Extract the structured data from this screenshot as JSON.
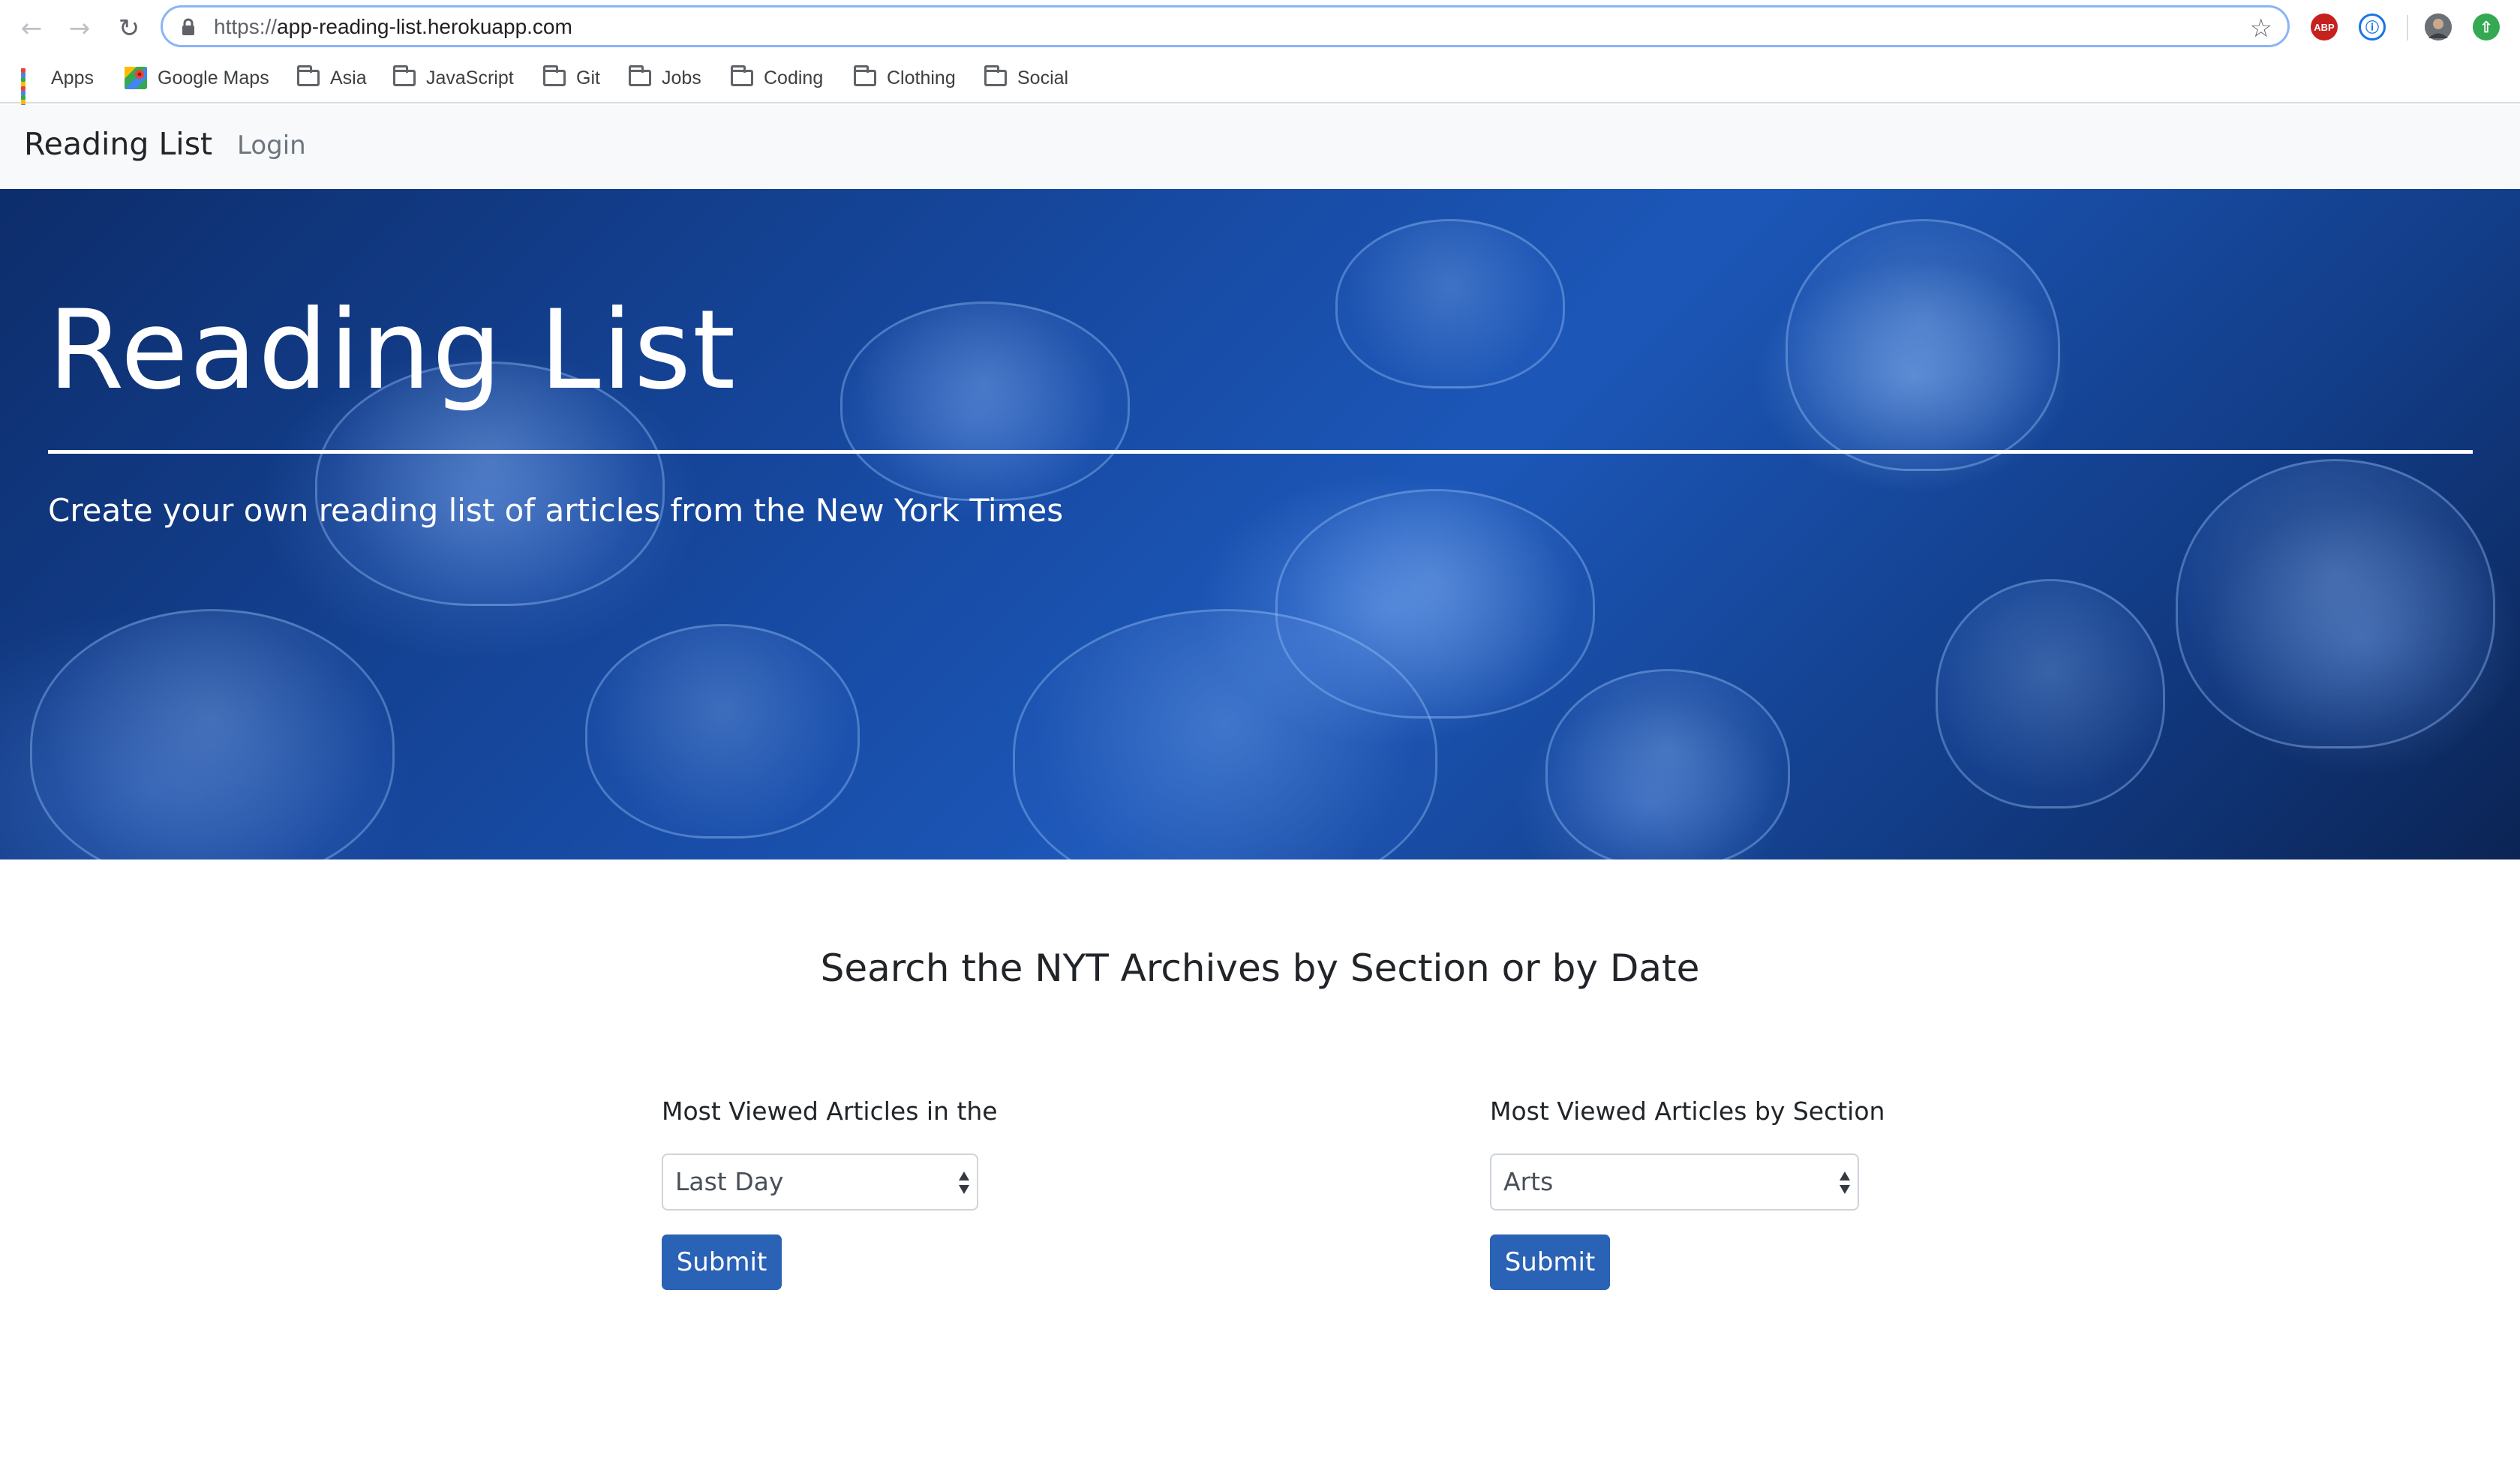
{
  "browser": {
    "url_scheme": "https://",
    "url_host": "app-reading-list.herokuapp.com",
    "bookmarks": [
      {
        "label": "Apps",
        "icon": "apps-grid-icon"
      },
      {
        "label": "Google Maps",
        "icon": "google-maps-icon"
      },
      {
        "label": "Asia",
        "icon": "folder-icon"
      },
      {
        "label": "JavaScript",
        "icon": "folder-icon"
      },
      {
        "label": "Git",
        "icon": "folder-icon"
      },
      {
        "label": "Jobs",
        "icon": "folder-icon"
      },
      {
        "label": "Coding",
        "icon": "folder-icon"
      },
      {
        "label": "Clothing",
        "icon": "folder-icon"
      },
      {
        "label": "Social",
        "icon": "folder-icon"
      }
    ],
    "extensions": {
      "adblock_label": "ABP"
    }
  },
  "navbar": {
    "brand": "Reading List",
    "login": "Login"
  },
  "hero": {
    "title": "Reading List",
    "lead": "Create your own reading list of articles from the New York Times"
  },
  "search": {
    "title": "Search the NYT Archives by Section or by Date",
    "period": {
      "label": "Most Viewed Articles in the",
      "selected": "Last Day",
      "submit": "Submit"
    },
    "section": {
      "label": "Most Viewed Articles by Section",
      "selected": "Arts",
      "submit": "Submit"
    }
  },
  "colors": {
    "primary_button": "#2a62b5",
    "navbar_bg": "#f8f9fa",
    "omnibox_focus": "#8ab4f8"
  }
}
